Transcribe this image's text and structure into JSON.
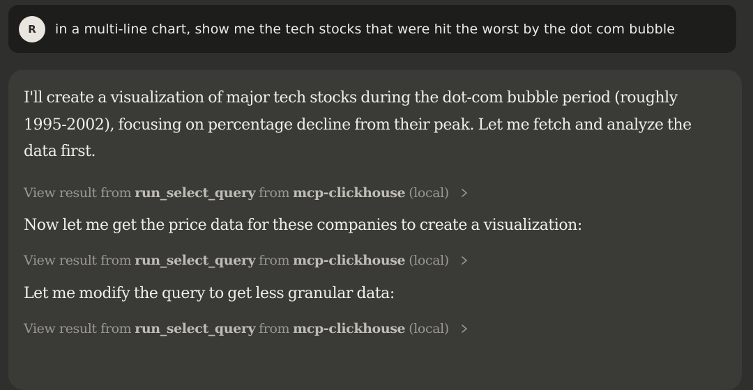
{
  "user": {
    "avatar_initial": "R",
    "message": "in a multi-line chart, show me the tech stocks that were hit the worst by the dot com bubble"
  },
  "assistant": {
    "intro": "I'll create a visualization of major tech stocks during the dot-com bubble period (roughly 1995-2002), focusing on percentage decline from their peak. Let me fetch and analyze the data first.",
    "tool_results": [
      {
        "prefix": "View result from",
        "tool": "run_select_query",
        "mid": "from",
        "server": "mcp-clickhouse",
        "suffix": "(local)",
        "icon": "chevron-right-icon"
      },
      {
        "prefix": "View result from",
        "tool": "run_select_query",
        "mid": "from",
        "server": "mcp-clickhouse",
        "suffix": "(local)",
        "icon": "chevron-right-icon"
      },
      {
        "prefix": "View result from",
        "tool": "run_select_query",
        "mid": "from",
        "server": "mcp-clickhouse",
        "suffix": "(local)",
        "icon": "chevron-right-icon"
      }
    ],
    "line_2": "Now let me get the price data for these companies to create a visualization:",
    "line_3": "Let me modify the query to get less granular data:"
  }
}
